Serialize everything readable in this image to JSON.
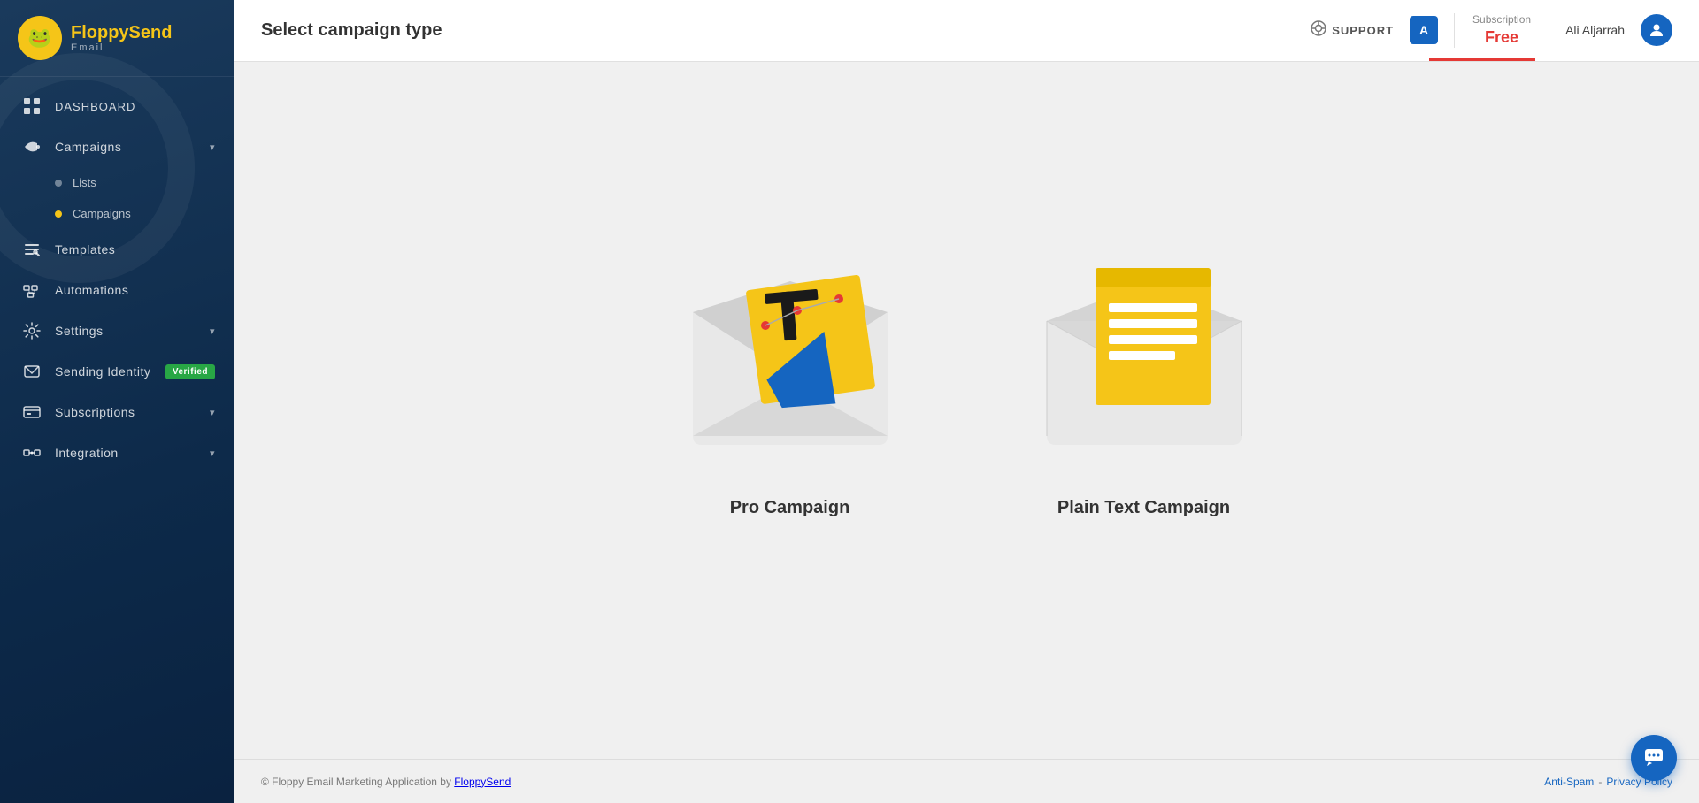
{
  "sidebar": {
    "logo": {
      "icon": "🐸",
      "brand_part1": "Floppy",
      "brand_part2": "Send",
      "sub_brand": "Email"
    },
    "items": [
      {
        "id": "dashboard",
        "label": "DASHBOARD",
        "icon": "⊞",
        "has_chevron": false
      },
      {
        "id": "campaigns",
        "label": "Campaigns",
        "icon": "📣",
        "has_chevron": true
      },
      {
        "id": "lists",
        "label": "Lists",
        "sub": true,
        "dot_active": false
      },
      {
        "id": "campaigns-sub",
        "label": "Campaigns",
        "sub": true,
        "dot_active": true
      },
      {
        "id": "templates",
        "label": "Templates",
        "icon": "✂",
        "has_chevron": false
      },
      {
        "id": "automations",
        "label": "Automations",
        "icon": "⊞",
        "has_chevron": false
      },
      {
        "id": "settings",
        "label": "Settings",
        "icon": "⊞",
        "has_chevron": true
      },
      {
        "id": "sending-identity",
        "label": "Sending Identity",
        "icon": "✉",
        "has_chevron": false,
        "badge": "Verified"
      },
      {
        "id": "subscriptions",
        "label": "Subscriptions",
        "icon": "💳",
        "has_chevron": true
      },
      {
        "id": "integration",
        "label": "Integration",
        "icon": "⊞",
        "has_chevron": true
      }
    ]
  },
  "header": {
    "title": "Select campaign type",
    "support_label": "SUPPORT",
    "avatar_letter": "A",
    "subscription_label": "Subscription",
    "subscription_value": "Free",
    "user_name": "Ali Aljarrah"
  },
  "campaigns": [
    {
      "id": "pro",
      "label": "Pro Campaign",
      "type": "pro"
    },
    {
      "id": "plain",
      "label": "Plain Text Campaign",
      "type": "plain"
    }
  ],
  "footer": {
    "copyright": "© Floppy Email Marketing Application by ",
    "brand_link": "FloppySend",
    "anti_spam": "Anti-Spam",
    "separator": " - ",
    "privacy": "Privacy Policy"
  },
  "colors": {
    "brand_blue": "#1a3a5c",
    "accent_blue": "#1565c0",
    "accent_red": "#e53935",
    "accent_yellow": "#f5c518",
    "verified_green": "#28a745"
  }
}
